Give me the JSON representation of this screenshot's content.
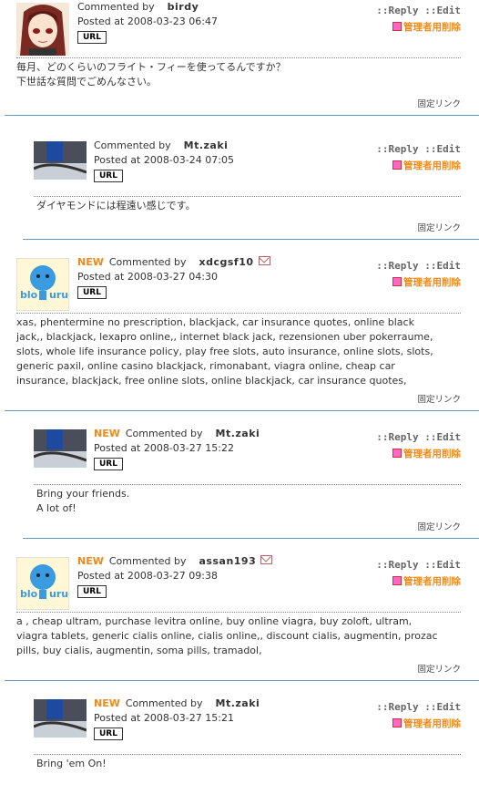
{
  "labels": {
    "commented_by": "Commented by",
    "posted_at": "Posted at",
    "url": "URL",
    "reply": "::Reply",
    "edit": "::Edit",
    "admin_delete": "管理者用削除",
    "permalink": "固定リンク",
    "new": "NEW"
  },
  "comments": [
    {
      "author": "birdy",
      "date": "2008-03-23 06:47",
      "lines": [
        "毎月、どのくらいのフライト・フィーを使ってるんですか？",
        "下世話な質問でごめんなさい。"
      ]
    },
    {
      "author": "Mt.zaki",
      "date": "2008-03-24 07:05",
      "lines": [
        "ダイヤモンドには程遠い感じです。"
      ]
    },
    {
      "author": "xdcgsf10",
      "date": "2008-03-27 04:30",
      "lines": [
        "xas, phentermine no prescription, blackjack, car insurance quotes, online black",
        "jack,, blackjack, lexapro online,, internet black jack, rezensionen uber pokerraume,",
        "slots, whole life insurance policy, play free slots, auto insurance, online slots, slots,",
        "generic paxil, online casino blackjack, rimonabant, viagra online, cheap car",
        "insurance, blackjack, free online slots, online blackjack, car insurance quotes,"
      ]
    },
    {
      "author": "Mt.zaki",
      "date": "2008-03-27 15:22",
      "lines": [
        "Bring your friends.",
        "A lot of!"
      ]
    },
    {
      "author": "assan193",
      "date": "2008-03-27 09:38",
      "lines": [
        "a , cheap ultram, purchase levitra online, buy online viagra, buy zoloft, ultram,",
        "viagra tablets, generic cialis online, cialis online,, discount cialis, augmentin, prozac",
        "pills, buy cialis, augmentin, soma pills, tramadol,"
      ]
    },
    {
      "author": "Mt.zaki",
      "date": "2008-03-27 15:21",
      "lines": [
        "Bring 'em On!"
      ]
    }
  ]
}
